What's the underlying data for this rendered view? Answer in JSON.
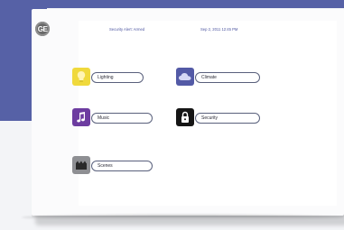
{
  "header": {
    "brand": "GE",
    "status_left": "Security Alert: Armed",
    "status_right": "Sep 2, 2011 12:45 PM"
  },
  "tiles": [
    {
      "label": "Lighting",
      "icon": "light-bulb-icon"
    },
    {
      "label": "Climate",
      "icon": "cloud-icon"
    },
    {
      "label": "Music",
      "icon": "music-note-icon"
    },
    {
      "label": "Security",
      "icon": "lock-icon"
    },
    {
      "label": "Scenes",
      "icon": "scene-icon"
    }
  ],
  "colors": {
    "accent": "#5661a6",
    "lighting": "#f0d93c",
    "climate": "#535aa6",
    "music": "#6d3ca0",
    "security": "#151515",
    "scenes": "#8e8f93"
  }
}
